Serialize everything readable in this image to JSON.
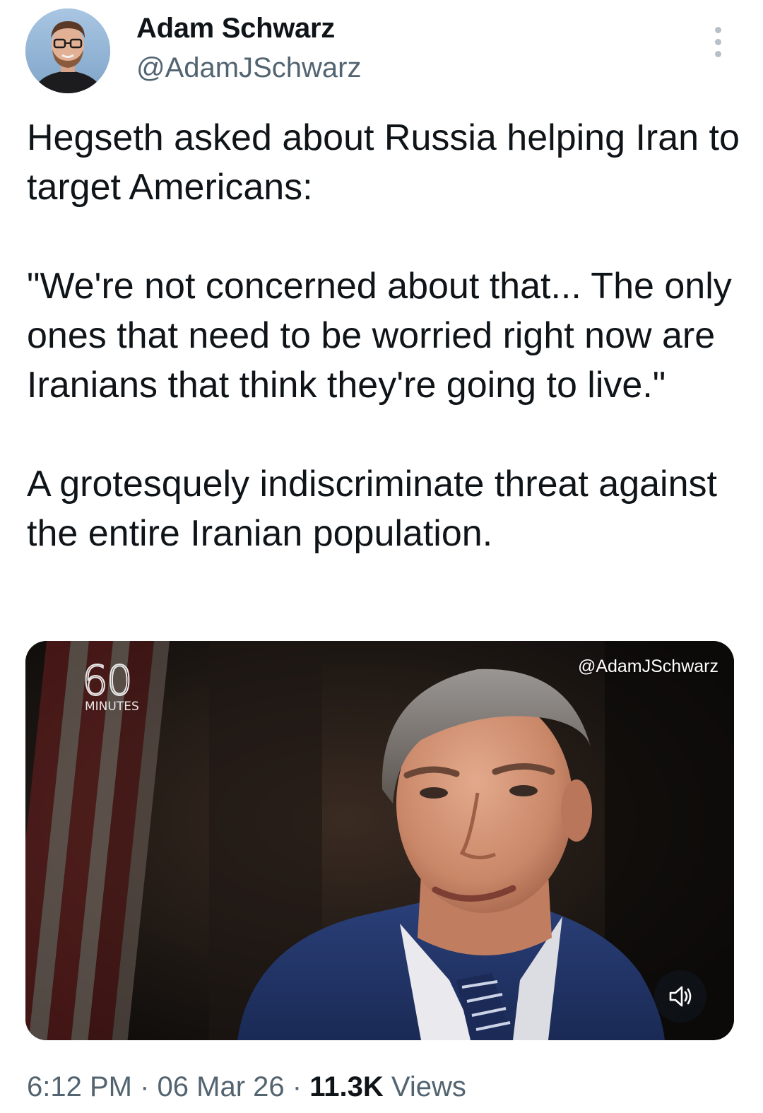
{
  "author": {
    "display_name": "Adam Schwarz",
    "handle": "@AdamJSchwarz",
    "avatar_icon": "profile-photo-avatar"
  },
  "header": {
    "more_icon": "more-vertical-icon"
  },
  "tweet": {
    "paragraphs": [
      "Hegseth asked about Russia helping Iran to target Americans:",
      "\"We're not concerned about that... The only ones that need to be worried right now are Iranians that think they're going to live.\"",
      "A grotesquely indiscriminate threat against the entire Iranian population."
    ]
  },
  "media": {
    "type": "video",
    "logo_number": "60",
    "logo_word": "MINUTES",
    "watermark": "@AdamJSchwarz",
    "mute_icon": "speaker-muted-icon"
  },
  "meta": {
    "time": "6:12 PM",
    "separator": "·",
    "date": "06 Mar 26",
    "views_count": "11.3K",
    "views_label": "Views"
  },
  "colors": {
    "text_primary": "#0f1419",
    "text_secondary": "#536471",
    "media_background": "#141110",
    "more_dots": "#b7c0c8"
  }
}
